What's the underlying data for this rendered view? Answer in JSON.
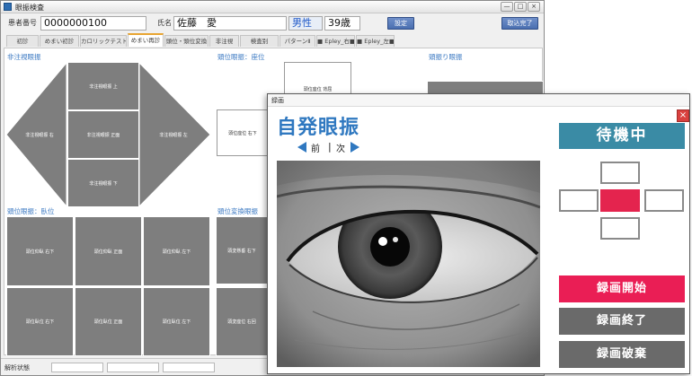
{
  "main_window": {
    "title": "眼振検査",
    "window_controls": [
      "—",
      "□",
      "×"
    ]
  },
  "patient": {
    "id_label": "患者番号",
    "id_value": "0000000100",
    "name_label": "氏名",
    "name_value": "佐藤　愛",
    "gender": "男性",
    "age": "39歳",
    "settings_button": "設定",
    "finish_button": "取込完了"
  },
  "tabs": [
    {
      "label": "初診"
    },
    {
      "label": "めまい初診"
    },
    {
      "label": "カロリックテスト"
    },
    {
      "label": "めまい再診"
    },
    {
      "label": "頭位・頭位変換"
    },
    {
      "label": "非注視"
    },
    {
      "label": "検査别"
    },
    {
      "label": "パターンⅡ"
    },
    {
      "label": "■ Epley_右■"
    },
    {
      "label": "■ Epley_左■"
    }
  ],
  "sections": {
    "non_gaze": {
      "title": "非注視眼振",
      "cells": {
        "up": "非注視眼振 上",
        "right": "非注視眼振 右",
        "front": "非注視眼振 正面",
        "left": "非注視眼振 左",
        "down": "非注視眼振 下"
      }
    },
    "head_position_sitting": {
      "title": "頭位眼振：座位",
      "cells": {
        "back": "頭位座位 背屈",
        "right_down": "頭位座位 右下"
      }
    },
    "head_shake": {
      "title": "頭振り眼振"
    },
    "head_position_lying": {
      "title": "頭位眼振：臥位",
      "row1": [
        "頭位仰臥 右下",
        "頭位仰臥 正面",
        "頭位仰臥 左下"
      ],
      "row2": [
        "頭位臥位 右下",
        "頭位臥位 正面",
        "頭位臥位 左下"
      ]
    },
    "head_position_change": {
      "title": "頭位変換眼振",
      "cells": [
        "頭変懸垂 右下",
        "頭変座位 右回"
      ]
    }
  },
  "status_bar": {
    "label": "解析状態"
  },
  "recording_window": {
    "title": "録画",
    "close_glyph": "×",
    "mode_title": "自発眼振",
    "nav_prev": "前",
    "nav_separator": "|",
    "nav_next": "次",
    "status": "待機中",
    "direction_selected": "center",
    "buttons": {
      "start": "録画開始",
      "stop": "録画終了",
      "discard": "録画破棄"
    }
  },
  "colors": {
    "accent_blue": "#2f78c0",
    "status_banner": "#3a8ba5",
    "record_red": "#ea1e55",
    "button_gray": "#6a6a6a",
    "cell_gray": "#7e7e7e"
  }
}
